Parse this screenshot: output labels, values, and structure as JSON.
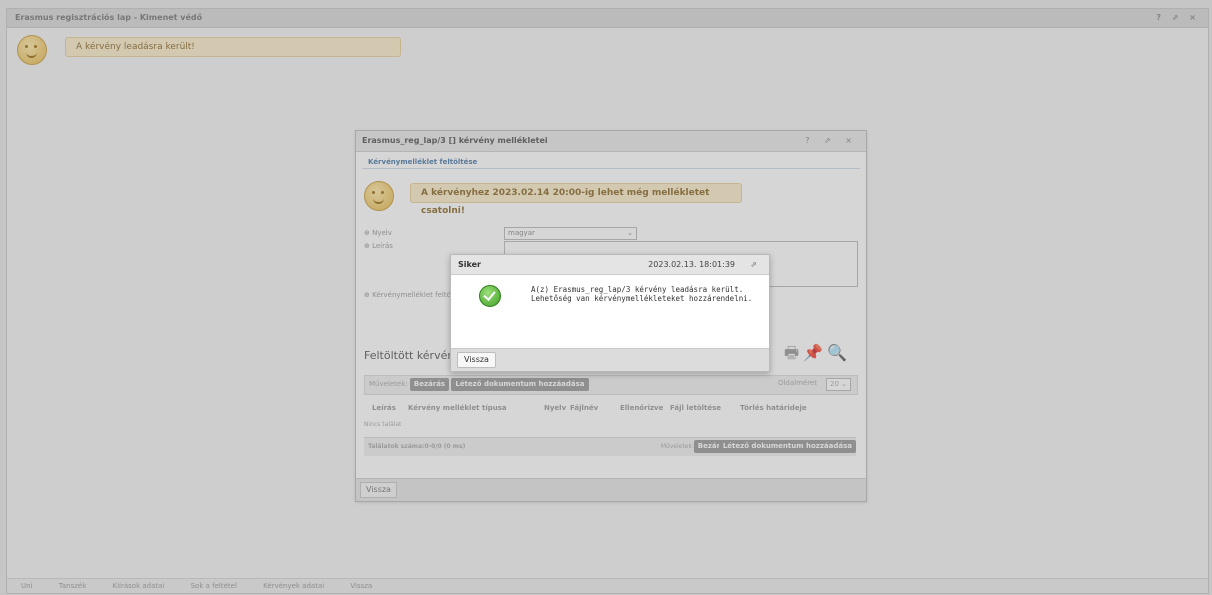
{
  "app": {
    "title": "Erasmus regisztrációs lap - Kimenet védő",
    "window_controls": "? ⇗ ×",
    "message": "A kérvény leadásra került!",
    "footer_items": [
      "Uni",
      "Tanszék",
      "Kiírások adatai",
      "Sok a feltétel",
      "Kérvények adatai",
      "Vissza"
    ]
  },
  "attachments_window": {
    "title": "Erasmus_reg_lap/3 [] kérvény mellékletei",
    "window_controls": "? ⇗ ×",
    "section_label": "Kérvénymelléklet feltöltése",
    "message": "A kérvényhez 2023.02.14 20:00-ig lehet még mellékletet csatolni!",
    "fields": {
      "language_label": "⊕ Nyelv",
      "language_value": "magyar",
      "description_label": "⊕ Leírás",
      "upload_label": "⊕ Kérvénymelléklet feltö"
    },
    "uploaded_title": "Feltöltött kérvénym",
    "toolbar": {
      "actions_label": "Műveletek:",
      "close_button": "Bezárás",
      "add_existing_button": "Létező dokumentum hozzáadása",
      "page_size_label": "Oldalméret",
      "page_size_value": "20"
    },
    "columns": [
      "Leírás",
      "Kérvény melléklet típusa",
      "Nyelv",
      "Fájlnév",
      "Ellenőrizve",
      "Fájl letöltése",
      "Törlés határideje"
    ],
    "empty_text": "Nincs találat",
    "footer": {
      "results_text": "Találatok száma:0-0/0 (0 ms)",
      "actions_label": "Műveletek:",
      "close_button": "Bezárás",
      "add_existing_button": "Létező dokumentum hozzáadása"
    },
    "back_button": "Vissza"
  },
  "dialog": {
    "title": "Siker",
    "timestamp": "2023.02.13. 18:01:39",
    "message": "A(z) Erasmus_reg_lap/3 kérvény leadásra került. Lehetőség van kérvénymellékleteket hozzárendelni.",
    "back_button": "Vissza"
  }
}
